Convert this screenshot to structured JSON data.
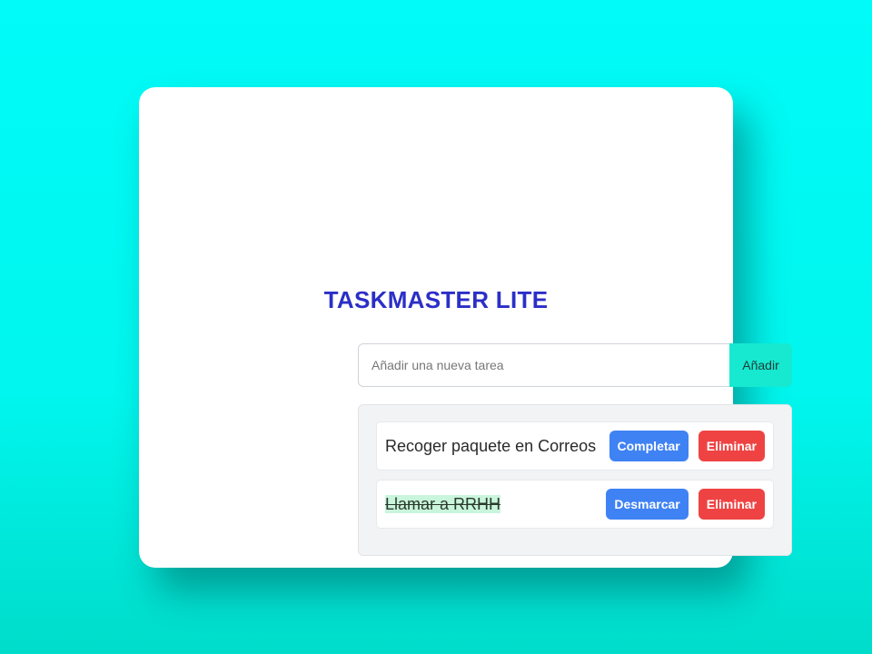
{
  "app": {
    "title": "TASKMASTER LITE"
  },
  "add_form": {
    "placeholder": "Añadir una nueva tarea",
    "value": "",
    "button_label": "Añadir"
  },
  "tasks": [
    {
      "text": "Recoger paquete en Correos",
      "completed": false,
      "toggle_label": "Completar",
      "delete_label": "Eliminar"
    },
    {
      "text": "Llamar a RRHH",
      "completed": true,
      "toggle_label": "Desmarcar",
      "delete_label": "Eliminar"
    }
  ],
  "colors": {
    "background": "#00fbf8",
    "title": "#2b2fc7",
    "add_button": "#16e9cf",
    "toggle_button": "#3f82f4",
    "delete_button": "#ef4343",
    "completed_highlight": "#c9f5dd"
  }
}
